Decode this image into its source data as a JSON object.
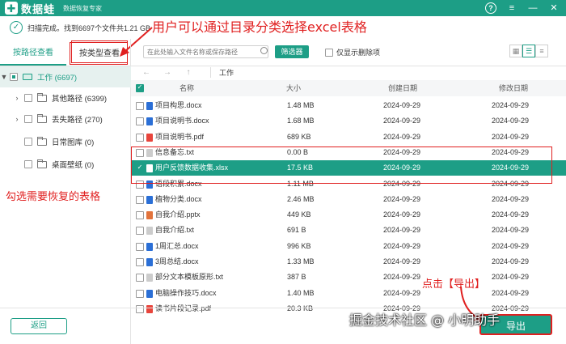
{
  "app": {
    "name": "数据蛙",
    "subtitle": "数据恢复专家",
    "logo_mark": "✚",
    "controls": {
      "help": "?",
      "menu": "≡",
      "minimize": "—",
      "close": "✕"
    }
  },
  "scan": {
    "status": "扫描完成。找到6697个文件共1.21 GB"
  },
  "annotations": {
    "top": "用户可以通过目录分类选择excel表格",
    "left": "勾选需要恢复的表格",
    "export_hint": "点击【导出】"
  },
  "left_panel": {
    "tabs": [
      {
        "label": "按路径查看"
      },
      {
        "label": "按类型查看"
      }
    ],
    "tree": [
      {
        "label": "工作 (6697)"
      },
      {
        "label": "其他路径 (6399)"
      },
      {
        "label": "丢失路径 (270)"
      },
      {
        "label": "日常图库 (0)"
      },
      {
        "label": "桌面壁纸 (0)"
      }
    ],
    "back_label": "返回"
  },
  "toolbar": {
    "search_placeholder": "在此处输入文件名称或保存路径",
    "filter_label": "筛选器",
    "only_deleted_label": "仅显示删除项"
  },
  "nav": {
    "back": "←",
    "forward": "→",
    "up": "↑",
    "path": "工作"
  },
  "table": {
    "headers": {
      "name": "名称",
      "size": "大小",
      "created": "创建日期",
      "modified": "修改日期"
    },
    "rows": [
      {
        "name": "项目构思.docx",
        "size": "1.48 MB",
        "created": "2024-09-29",
        "modified": "2024-09-29",
        "type": "docx"
      },
      {
        "name": "项目说明书.docx",
        "size": "1.68 MB",
        "created": "2024-09-29",
        "modified": "2024-09-29",
        "type": "docx"
      },
      {
        "name": "项目说明书.pdf",
        "size": "689 KB",
        "created": "2024-09-29",
        "modified": "2024-09-29",
        "type": "pdf"
      },
      {
        "name": "信息备忘.txt",
        "size": "0.00 B",
        "created": "2024-09-29",
        "modified": "2024-09-29",
        "type": "txt"
      },
      {
        "name": "用户反馈数据收集.xlsx",
        "size": "17.5 KB",
        "created": "2024-09-29",
        "modified": "2024-09-29",
        "type": "xlsx"
      },
      {
        "name": "语段积累.docx",
        "size": "1.11 MB",
        "created": "2024-09-29",
        "modified": "2024-09-29",
        "type": "docx"
      },
      {
        "name": "植物分类.docx",
        "size": "2.46 MB",
        "created": "2024-09-29",
        "modified": "2024-09-29",
        "type": "docx"
      },
      {
        "name": "自我介绍.pptx",
        "size": "449 KB",
        "created": "2024-09-29",
        "modified": "2024-09-29",
        "type": "pptx"
      },
      {
        "name": "自我介绍.txt",
        "size": "691 B",
        "created": "2024-09-29",
        "modified": "2024-09-29",
        "type": "txt"
      },
      {
        "name": "1周汇总.docx",
        "size": "996 KB",
        "created": "2024-09-29",
        "modified": "2024-09-29",
        "type": "docx"
      },
      {
        "name": "3周总结.docx",
        "size": "1.33 MB",
        "created": "2024-09-29",
        "modified": "2024-09-29",
        "type": "docx"
      },
      {
        "name": "部分文本模板原形.txt",
        "size": "387 B",
        "created": "2024-09-29",
        "modified": "2024-09-29",
        "type": "txt"
      },
      {
        "name": "电脑操作技巧.docx",
        "size": "1.40 MB",
        "created": "2024-09-29",
        "modified": "2024-09-29",
        "type": "docx"
      },
      {
        "name": "读书片段记录.pdf",
        "size": "20.3 KB",
        "created": "2024-09-29",
        "modified": "2024-09-29",
        "type": "pdf"
      }
    ]
  },
  "export_label": "导出",
  "watermark": "掘金技术社区 @ 小明助手",
  "colors": {
    "accent": "#1d9e86",
    "annotation": "#e02020"
  }
}
